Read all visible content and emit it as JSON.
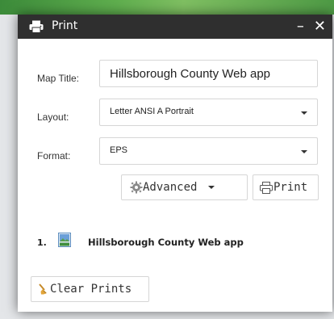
{
  "dialog": {
    "title": "Print",
    "minimize_label": "–",
    "close_label": "✕"
  },
  "form": {
    "map_title": {
      "label": "Map Title:",
      "value": "Hillsborough County Web app"
    },
    "layout": {
      "label": "Layout:",
      "value": "Letter ANSI A Portrait"
    },
    "format": {
      "label": "Format:",
      "value": "EPS"
    }
  },
  "buttons": {
    "advanced_label": "Advanced",
    "print_label": "Print",
    "clear_label": "Clear Prints"
  },
  "results": [
    {
      "index": "1.",
      "title": "Hillsborough County Web app",
      "icon": "map-document-icon"
    }
  ],
  "colors": {
    "titlebar": "#2f2f2f",
    "border": "#d6d6d6",
    "text": "#222222"
  }
}
